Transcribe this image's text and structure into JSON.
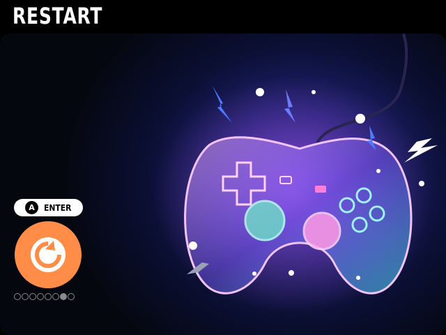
{
  "title": "RESTART",
  "hint": {
    "key": "A",
    "label": "ENTER"
  },
  "action": {
    "icon": "restart-icon",
    "color": "#ff8c47"
  },
  "pagination": {
    "total": 8,
    "active_index": 6
  },
  "colors": {
    "background": "#000000",
    "accent": "#ff8c47"
  }
}
